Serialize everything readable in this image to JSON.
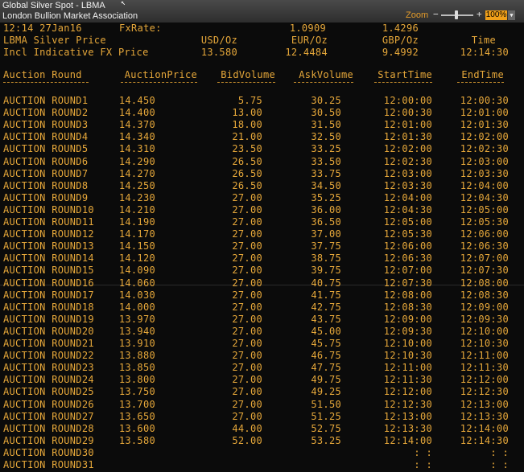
{
  "window": {
    "title": "Global Silver Spot - LBMA",
    "subtitle": "London Bullion Market Association",
    "zoom_label": "Zoom",
    "zoom_minus": "−",
    "zoom_plus": "+",
    "zoom_value": "100%",
    "zoom_dropdown": "▼"
  },
  "info": {
    "datetime": "12:14 27Jan16",
    "fxrate_label": "FxRate:",
    "fx_eur": "1.0909",
    "fx_gbp": "1.4296",
    "price_label": "LBMA Silver Price",
    "usd_label": "USD/Oz",
    "eur_label": "EUR/Oz",
    "gbp_label": "GBP/Oz",
    "time_label": "Time",
    "fx_price_label": "Incl Indicative FX Price",
    "usd_value": "13.580",
    "eur_value": "12.4484",
    "gbp_value": "9.4992",
    "time_value": "12:14:30"
  },
  "table": {
    "headers": [
      "Auction Round",
      "AuctionPrice",
      "BidVolume",
      "AskVolume",
      "StartTime",
      "EndTime"
    ],
    "rows": [
      [
        "AUCTION ROUND1",
        "14.450",
        "5.75",
        "30.25",
        "12:00:00",
        "12:00:30"
      ],
      [
        "AUCTION ROUND2",
        "14.400",
        "13.00",
        "30.50",
        "12:00:30",
        "12:01:00"
      ],
      [
        "AUCTION ROUND3",
        "14.370",
        "18.00",
        "31.50",
        "12:01:00",
        "12:01:30"
      ],
      [
        "AUCTION ROUND4",
        "14.340",
        "21.00",
        "32.50",
        "12:01:30",
        "12:02:00"
      ],
      [
        "AUCTION ROUND5",
        "14.310",
        "23.50",
        "33.25",
        "12:02:00",
        "12:02:30"
      ],
      [
        "AUCTION ROUND6",
        "14.290",
        "26.50",
        "33.50",
        "12:02:30",
        "12:03:00"
      ],
      [
        "AUCTION ROUND7",
        "14.270",
        "26.50",
        "33.75",
        "12:03:00",
        "12:03:30"
      ],
      [
        "AUCTION ROUND8",
        "14.250",
        "26.50",
        "34.50",
        "12:03:30",
        "12:04:00"
      ],
      [
        "AUCTION ROUND9",
        "14.230",
        "27.00",
        "35.25",
        "12:04:00",
        "12:04:30"
      ],
      [
        "AUCTION ROUND10",
        "14.210",
        "27.00",
        "36.00",
        "12:04:30",
        "12:05:00"
      ],
      [
        "AUCTION ROUND11",
        "14.190",
        "27.00",
        "36.50",
        "12:05:00",
        "12:05:30"
      ],
      [
        "AUCTION ROUND12",
        "14.170",
        "27.00",
        "37.00",
        "12:05:30",
        "12:06:00"
      ],
      [
        "AUCTION ROUND13",
        "14.150",
        "27.00",
        "37.75",
        "12:06:00",
        "12:06:30"
      ],
      [
        "AUCTION ROUND14",
        "14.120",
        "27.00",
        "38.75",
        "12:06:30",
        "12:07:00"
      ],
      [
        "AUCTION ROUND15",
        "14.090",
        "27.00",
        "39.75",
        "12:07:00",
        "12:07:30"
      ],
      [
        "AUCTION ROUND16",
        "14.060",
        "27.00",
        "40.75",
        "12:07:30",
        "12:08:00"
      ],
      [
        "AUCTION ROUND17",
        "14.030",
        "27.00",
        "41.75",
        "12:08:00",
        "12:08:30"
      ],
      [
        "AUCTION ROUND18",
        "14.000",
        "27.00",
        "42.75",
        "12:08:30",
        "12:09:00"
      ],
      [
        "AUCTION ROUND19",
        "13.970",
        "27.00",
        "43.75",
        "12:09:00",
        "12:09:30"
      ],
      [
        "AUCTION ROUND20",
        "13.940",
        "27.00",
        "45.00",
        "12:09:30",
        "12:10:00"
      ],
      [
        "AUCTION ROUND21",
        "13.910",
        "27.00",
        "45.75",
        "12:10:00",
        "12:10:30"
      ],
      [
        "AUCTION ROUND22",
        "13.880",
        "27.00",
        "46.75",
        "12:10:30",
        "12:11:00"
      ],
      [
        "AUCTION ROUND23",
        "13.850",
        "27.00",
        "47.75",
        "12:11:00",
        "12:11:30"
      ],
      [
        "AUCTION ROUND24",
        "13.800",
        "27.00",
        "49.75",
        "12:11:30",
        "12:12:00"
      ],
      [
        "AUCTION ROUND25",
        "13.750",
        "27.00",
        "49.25",
        "12:12:00",
        "12:12:30"
      ],
      [
        "AUCTION ROUND26",
        "13.700",
        "27.00",
        "51.50",
        "12:12:30",
        "12:13:00"
      ],
      [
        "AUCTION ROUND27",
        "13.650",
        "27.00",
        "51.25",
        "12:13:00",
        "12:13:30"
      ],
      [
        "AUCTION ROUND28",
        "13.600",
        "44.00",
        "52.75",
        "12:13:30",
        "12:14:00"
      ],
      [
        "AUCTION ROUND29",
        "13.580",
        "52.00",
        "53.25",
        "12:14:00",
        "12:14:30"
      ],
      [
        "AUCTION ROUND30",
        "",
        "",
        "",
        ": :",
        ": :"
      ],
      [
        "AUCTION ROUND31",
        "",
        "",
        "",
        ": :",
        ": :"
      ]
    ]
  },
  "colors": {
    "text": "#e7a83a",
    "background": "#0b0b0b",
    "zoom_accent": "#f0a019"
  }
}
